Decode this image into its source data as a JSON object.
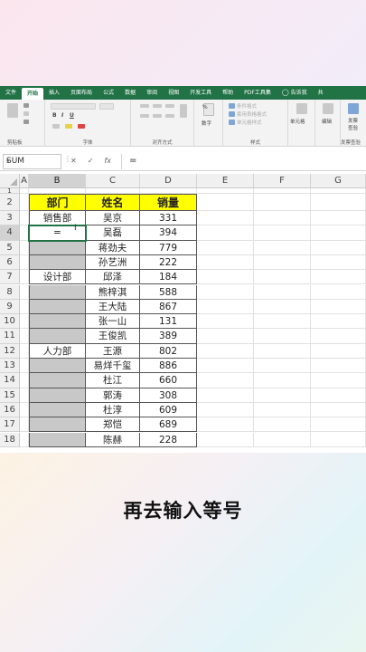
{
  "ribbon": {
    "tabs": [
      {
        "label": "文件"
      },
      {
        "label": "开始"
      },
      {
        "label": "插入"
      },
      {
        "label": "页面布局"
      },
      {
        "label": "公式"
      },
      {
        "label": "数据"
      },
      {
        "label": "审阅"
      },
      {
        "label": "视图"
      },
      {
        "label": "开发工具"
      },
      {
        "label": "帮助"
      },
      {
        "label": "PDF工具集"
      },
      {
        "label": "告诉我"
      },
      {
        "label": "共"
      }
    ],
    "active_tab": "开始",
    "groups": {
      "clipboard": "剪贴板",
      "font": "字体",
      "alignment": "对齐方式",
      "number": "数字",
      "styles": "样式",
      "cells": "单元格",
      "editing": "编辑",
      "invoice": "发票查验",
      "invoice_btn1": "发票",
      "invoice_btn2": "查验",
      "cond_format": "条件格式",
      "table_format": "套用表格格式",
      "cell_style": "单元格样式"
    }
  },
  "formula_bar": {
    "name_box": "SUM",
    "cancel": "✕",
    "confirm": "✓",
    "fx": "fx",
    "content": "="
  },
  "sheet": {
    "columns": [
      "A",
      "B",
      "C",
      "D",
      "E",
      "F",
      "G"
    ],
    "rows": [
      "1",
      "2",
      "3",
      "4",
      "5",
      "6",
      "7",
      "8",
      "9",
      "10",
      "11",
      "12",
      "13",
      "14",
      "15",
      "16",
      "17",
      "18"
    ],
    "headers": {
      "dept": "部门",
      "name": "姓名",
      "sales": "销量"
    },
    "data": [
      {
        "dept": "销售部",
        "name": "吴京",
        "sales": "331"
      },
      {
        "dept": "=",
        "name": "吴磊",
        "sales": "394"
      },
      {
        "dept": "",
        "name": "蒋劲夫",
        "sales": "779"
      },
      {
        "dept": "",
        "name": "孙艺洲",
        "sales": "222"
      },
      {
        "dept": "设计部",
        "name": "邱泽",
        "sales": "184"
      },
      {
        "dept": "",
        "name": "熊梓淇",
        "sales": "588"
      },
      {
        "dept": "",
        "name": "王大陆",
        "sales": "867"
      },
      {
        "dept": "",
        "name": "张一山",
        "sales": "131"
      },
      {
        "dept": "",
        "name": "王俊凯",
        "sales": "389"
      },
      {
        "dept": "人力部",
        "name": "王源",
        "sales": "802"
      },
      {
        "dept": "",
        "name": "易烊千玺",
        "sales": "886"
      },
      {
        "dept": "",
        "name": "杜江",
        "sales": "660"
      },
      {
        "dept": "",
        "name": "郭涛",
        "sales": "308"
      },
      {
        "dept": "",
        "name": "杜淳",
        "sales": "609"
      },
      {
        "dept": "",
        "name": "郑恺",
        "sales": "689"
      },
      {
        "dept": "",
        "name": "陈赫",
        "sales": "228"
      }
    ],
    "active_cell": "B4",
    "gray_fill": "#c8c8c8",
    "header_fill": "#ffff00"
  },
  "caption": "再去输入等号",
  "colors": {
    "excel_green": "#217346"
  }
}
